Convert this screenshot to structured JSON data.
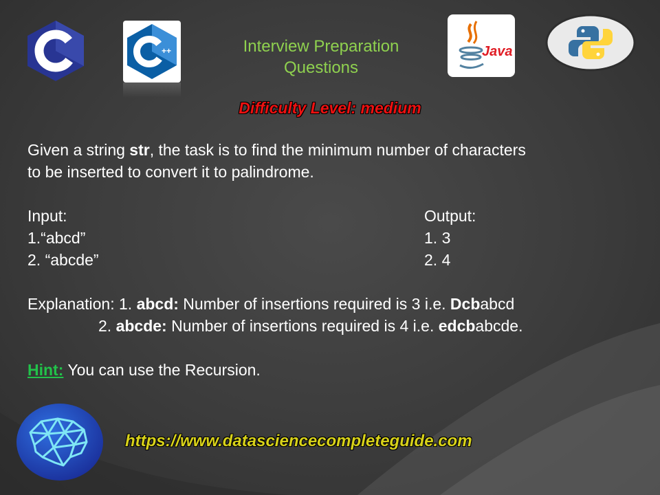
{
  "title": {
    "line1": "Interview Preparation",
    "line2": "Questions"
  },
  "difficulty": "Difficulty Level: medium",
  "problem": {
    "pre": "Given a string ",
    "keyword": "str",
    "post": ", the task is to find the minimum number of characters",
    "line2": "to be inserted to convert it to palindrome."
  },
  "input": {
    "label": "Input:",
    "items": [
      "1.“abcd”",
      "2. “abcde”"
    ]
  },
  "output": {
    "label": "Output:",
    "items": [
      "1. 3",
      "2. 4"
    ]
  },
  "explanation": {
    "prefix": "Explanation: 1. ",
    "e1_bold": "abcd:",
    "e1_text": " Number of insertions required is 3 i.e. ",
    "e1_answer_bold": "Dcb",
    "e1_answer_rest": "abcd",
    "e2_prefix": "2. ",
    "e2_bold": "abcde:",
    "e2_text": " Number of insertions required is 4 i.e. ",
    "e2_answer_bold": "edcb",
    "e2_answer_rest": "abcde."
  },
  "hint": {
    "label": "Hint:",
    "text": " You can use the Recursion."
  },
  "url": "https://www.datasciencecompleteguide.com",
  "logos": {
    "c": "C",
    "cpp": "C",
    "cpp_plus": "++",
    "java": "Java",
    "icons": [
      "c-logo-icon",
      "cpp-logo-icon",
      "java-logo-icon",
      "python-logo-icon",
      "brain-icon"
    ]
  },
  "colors": {
    "title": "#8fd14f",
    "difficulty": "#e11111",
    "hint": "#22c24a",
    "url": "#d8d21a",
    "background": "#3c3c3c"
  }
}
